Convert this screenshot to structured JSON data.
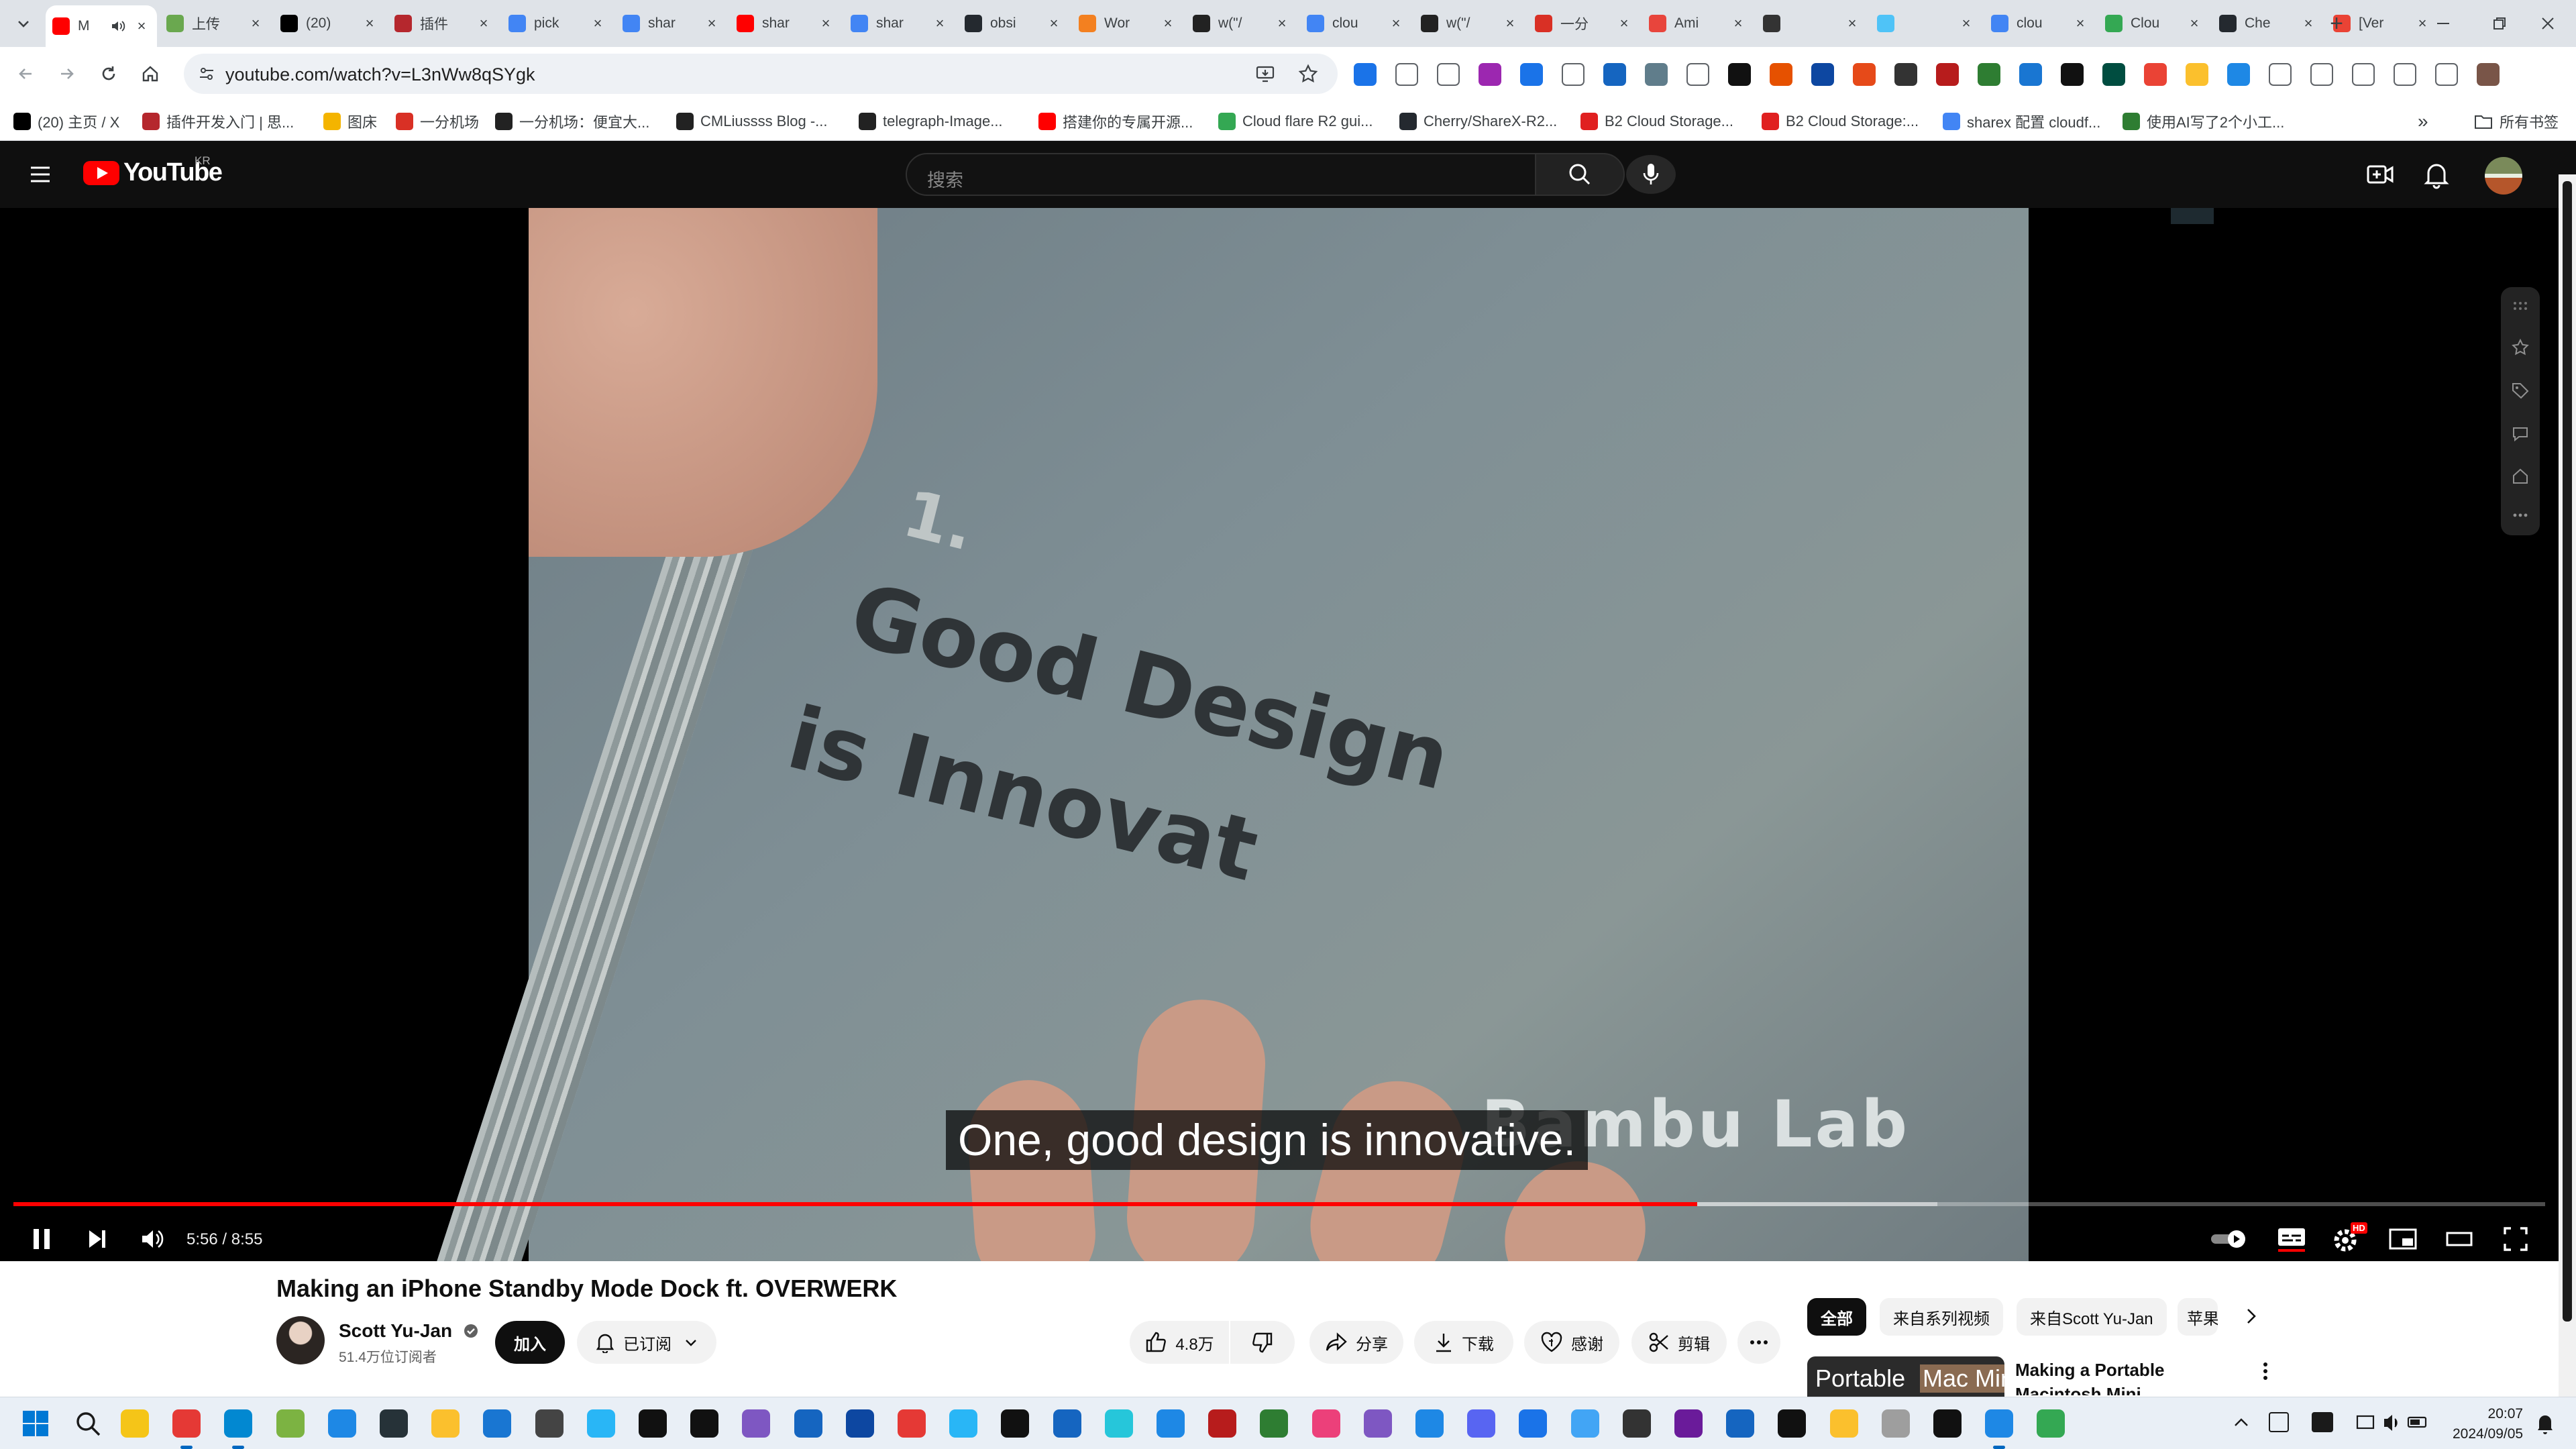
{
  "browser": {
    "tabs": [
      {
        "title": "M",
        "favicon": "youtube-icon",
        "color": "#ff0000",
        "active": true,
        "audio": true
      },
      {
        "title": "上传",
        "favicon": "upload-site-icon",
        "color": "#6aa84f"
      },
      {
        "title": "(20)",
        "favicon": "x-icon",
        "color": "#000000"
      },
      {
        "title": "插件",
        "favicon": "plugin-site-icon",
        "color": "#b5272d"
      },
      {
        "title": "pick",
        "favicon": "google-icon",
        "color": "#4285f4"
      },
      {
        "title": "shar",
        "favicon": "google-icon",
        "color": "#4285f4"
      },
      {
        "title": "shar",
        "favicon": "youtube-icon",
        "color": "#ff0000"
      },
      {
        "title": "shar",
        "favicon": "google-icon",
        "color": "#4285f4"
      },
      {
        "title": "obsi",
        "favicon": "github-icon",
        "color": "#24292f"
      },
      {
        "title": "Wor",
        "favicon": "cloudflare-icon",
        "color": "#f38020"
      },
      {
        "title": "w(\"/",
        "favicon": "cm-icon",
        "color": "#222222"
      },
      {
        "title": "clou",
        "favicon": "google-icon",
        "color": "#4285f4"
      },
      {
        "title": "w(\"/",
        "favicon": "cm-icon",
        "color": "#222222"
      },
      {
        "title": "一分",
        "favicon": "yifen-icon",
        "color": "#d93025"
      },
      {
        "title": "Ami",
        "favicon": "ami-icon",
        "color": "#e8453c"
      },
      {
        "title": "",
        "favicon": "grid-icon",
        "color": "#333333"
      },
      {
        "title": "",
        "favicon": "drop-icon",
        "color": "#4fc3f7"
      },
      {
        "title": "clou",
        "favicon": "google-icon",
        "color": "#4285f4"
      },
      {
        "title": "Clou",
        "favicon": "chrome-icon",
        "color": "#34a853"
      },
      {
        "title": "Che",
        "favicon": "github-icon",
        "color": "#24292f"
      },
      {
        "title": "[Ver",
        "favicon": "gmail-icon",
        "color": "#ea4335"
      }
    ],
    "new_tab": "+",
    "url": "youtube.com/watch?v=L3nWw8qSYgk",
    "bookmarks": [
      {
        "label": "(20) 主页 / X",
        "color": "#000000"
      },
      {
        "label": "插件开发入门 | 思...",
        "color": "#b5272d"
      },
      {
        "label": "图床",
        "color": "#f4b400"
      },
      {
        "label": "一分机场",
        "color": "#d93025"
      },
      {
        "label": "一分机场：便宜大...",
        "color": "#222222"
      },
      {
        "label": "CMLiussss Blog -...",
        "color": "#222222"
      },
      {
        "label": "telegraph-Image...",
        "color": "#222222"
      },
      {
        "label": "搭建你的专属开源...",
        "color": "#ff0000"
      },
      {
        "label": "Cloud flare R2 gui...",
        "color": "#34a853"
      },
      {
        "label": "Cherry/ShareX-R2...",
        "color": "#24292f"
      },
      {
        "label": "B2 Cloud Storage...",
        "color": "#e02020"
      },
      {
        "label": "B2 Cloud Storage:...",
        "color": "#e02020"
      },
      {
        "label": "sharex 配置 cloudf...",
        "color": "#4285f4"
      },
      {
        "label": "使用AI写了2个小工...",
        "color": "#2e7d32"
      }
    ],
    "all_bookmarks": "所有书签"
  },
  "youtube": {
    "logo": "YouTube",
    "region": "KR",
    "search_placeholder": "搜索",
    "player": {
      "subtitle": "One, good design is innovative.",
      "current_time": "5:56",
      "duration": "8:55",
      "time_display": "5:56 / 8:55",
      "progress_fraction": 0.665,
      "buffered_fraction": 0.76,
      "overlay_book_number": "1.",
      "overlay_book_line1": "Good Design",
      "overlay_book_line2": "is Innovat",
      "watermark": "Bambu Lab",
      "hd_badge": "HD"
    },
    "video": {
      "title": "Making an iPhone Standby Mode Dock ft. OVERWERK",
      "channel": "Scott Yu-Jan",
      "subscribers": "51.4万位订阅者",
      "join_label": "加入",
      "subscribed_label": "已订阅",
      "likes": "4.8万",
      "share_label": "分享",
      "download_label": "下载",
      "thanks_label": "感谢",
      "clip_label": "剪辑"
    },
    "chips": [
      "全部",
      "来自系列视频",
      "来自Scott Yu-Jan",
      "苹果"
    ],
    "recommendation": {
      "thumb_text_1": "Portable",
      "thumb_text_2": "Mac Mini",
      "title": "Making a Portable Macintosh Mini"
    }
  },
  "taskbar": {
    "time": "20:07",
    "date": "2024/09/05"
  },
  "colors": {
    "youtube_red": "#ff0000",
    "masthead_bg": "#0f0f0f",
    "chrome_frame": "#dfe3e8",
    "taskbar_bg": "#e9eff6"
  }
}
